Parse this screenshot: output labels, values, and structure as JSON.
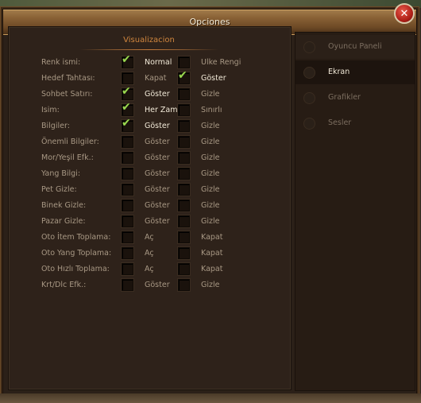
{
  "window": {
    "title": "Opciones"
  },
  "section": {
    "title": "Visualizacion"
  },
  "options": [
    {
      "label": "Renk ismi:",
      "opt1": "Normal",
      "opt2": "Ülke Rengi",
      "checked": 1
    },
    {
      "label": "Hedef Tahtası:",
      "opt1": "Kapat",
      "opt2": "Göster",
      "checked": 2
    },
    {
      "label": "Sohbet Satırı:",
      "opt1": "Göster",
      "opt2": "Gizle",
      "checked": 1
    },
    {
      "label": "Isim:",
      "opt1": "Her Zaman",
      "opt2": "Sınırlı",
      "checked": 1
    },
    {
      "label": "Bilgiler:",
      "opt1": "Göster",
      "opt2": "Gizle",
      "checked": 1
    },
    {
      "label": "Önemli Bilgiler:",
      "opt1": "Göster",
      "opt2": "Gizle",
      "checked": 0
    },
    {
      "label": "Mor/Yeşil Efk.:",
      "opt1": "Göster",
      "opt2": "Gizle",
      "checked": 0
    },
    {
      "label": "Yang Bilgi:",
      "opt1": "Göster",
      "opt2": "Gizle",
      "checked": 0
    },
    {
      "label": "Pet Gizle:",
      "opt1": "Göster",
      "opt2": "Gizle",
      "checked": 0
    },
    {
      "label": "Binek Gizle:",
      "opt1": "Göster",
      "opt2": "Gizle",
      "checked": 0
    },
    {
      "label": "Pazar Gizle:",
      "opt1": "Göster",
      "opt2": "Gizle",
      "checked": 0
    },
    {
      "label": "Oto İtem Toplama:",
      "opt1": "Aç",
      "opt2": "Kapat",
      "checked": 0
    },
    {
      "label": "Oto Yang Toplama:",
      "opt1": "Aç",
      "opt2": "Kapat",
      "checked": 0
    },
    {
      "label": "Oto Hızlı Toplama:",
      "opt1": "Aç",
      "opt2": "Kapat",
      "checked": 0
    },
    {
      "label": "Krt/Dlc Efk.:",
      "opt1": "Göster",
      "opt2": "Gizle",
      "checked": 0
    }
  ],
  "tabs": [
    {
      "label": "Oyuncu Paneli",
      "state": "dim"
    },
    {
      "label": "Ekran",
      "state": "active"
    },
    {
      "label": "Grafikler",
      "state": "normal"
    },
    {
      "label": "Sesler",
      "state": "normal"
    }
  ],
  "colors": {
    "check": "#9ad850",
    "section_title": "#d0863e",
    "title_bar": "#8a6236",
    "close": "#b02018"
  },
  "icons": {
    "check": "check-icon",
    "close": "close-icon",
    "tab": "radio-dot-icon"
  }
}
